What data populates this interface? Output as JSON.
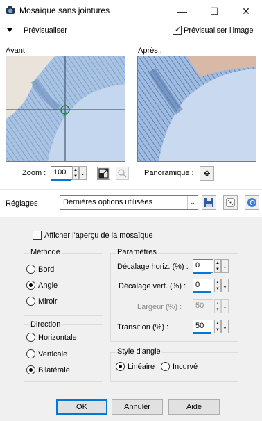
{
  "window": {
    "title": "Mosaïque sans jointures",
    "minimize_icon": "—",
    "maximize_icon": "☐",
    "close_icon": "✕"
  },
  "preview": {
    "toggle_label": "Prévisualiser",
    "preview_image_label": "Prévisualiser l'image",
    "preview_image_checked": true,
    "before_label": "Avant :",
    "after_label": "Après :"
  },
  "zoom": {
    "label": "Zoom :",
    "value": "100",
    "pan_label": "Panoramique :"
  },
  "settings": {
    "label": "Réglages",
    "selected": "Dernières options utilisées"
  },
  "options": {
    "tile_preview_label": "Afficher l'aperçu de la mosaïque",
    "tile_preview_checked": false
  },
  "method": {
    "title": "Méthode",
    "items": [
      {
        "label": "Bord",
        "checked": false
      },
      {
        "label": "Angle",
        "checked": true
      },
      {
        "label": "Miroir",
        "checked": false
      }
    ]
  },
  "direction": {
    "title": "Direction",
    "items": [
      {
        "label": "Horizontale",
        "checked": false
      },
      {
        "label": "Verticale",
        "checked": false
      },
      {
        "label": "Bilatérale",
        "checked": true
      }
    ]
  },
  "params": {
    "title": "Paramètres",
    "h_offset_label": "Décalage horiz. (%) :",
    "h_offset_value": "0",
    "v_offset_label": "Décalage vert. (%) :",
    "v_offset_value": "0",
    "width_label": "Largeur (%) :",
    "width_value": "50",
    "transition_label": "Transition (%) :",
    "transition_value": "50"
  },
  "angle_style": {
    "title": "Style d'angle",
    "linear_label": "Linéaire",
    "linear_checked": true,
    "curved_label": "Incurvé",
    "curved_checked": false
  },
  "buttons": {
    "ok": "OK",
    "cancel": "Annuler",
    "help": "Aide"
  },
  "colors": {
    "accent": "#0078d7",
    "panel": "#f0f0f0",
    "sweater": "#a9c3e3"
  }
}
